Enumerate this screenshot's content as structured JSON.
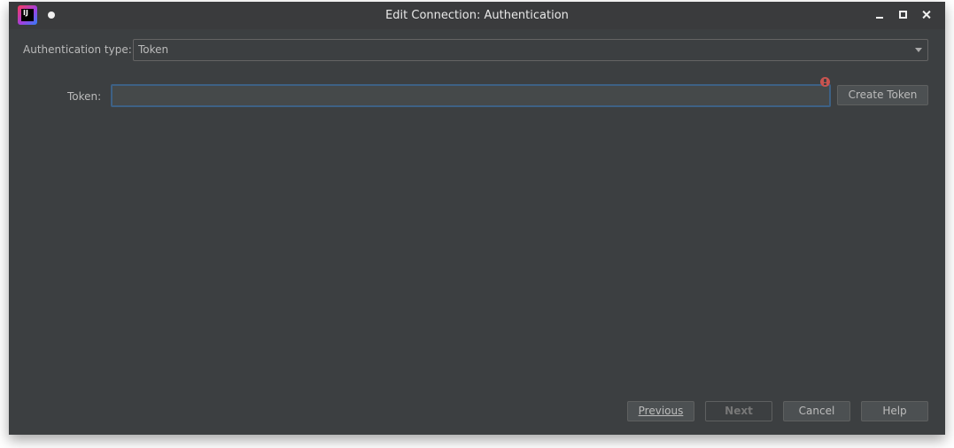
{
  "window": {
    "title": "Edit Connection: Authentication",
    "app_icon": "intellij-idea-icon",
    "app_icon_text": "IJ"
  },
  "auth": {
    "type_label": "Authentication type:",
    "type_value": "Token",
    "token_label": "Token:",
    "token_value": "",
    "create_token_label": "Create Token"
  },
  "footer": {
    "previous_label": "Previous",
    "next_label": "Next",
    "cancel_label": "Cancel",
    "help_label": "Help"
  },
  "colors": {
    "background": "#3c3f41",
    "titlebar": "#3a3b3d",
    "focus_border": "#3d6185",
    "error": "#c75450"
  }
}
